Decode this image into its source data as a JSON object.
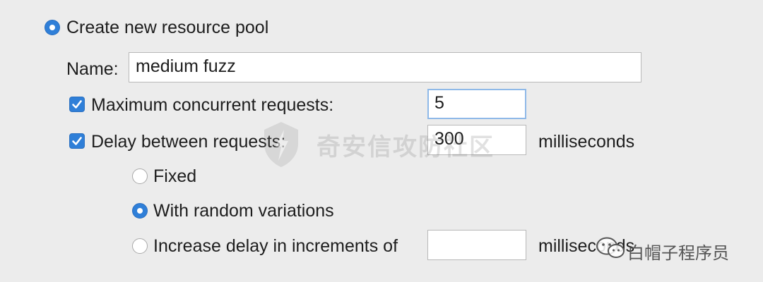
{
  "pool": {
    "create_label": "Create new resource pool",
    "name_label": "Name:",
    "name_value": "medium fuzz",
    "max_concurrent_label": "Maximum concurrent requests:",
    "max_concurrent_value": "5",
    "delay_label": "Delay between requests:",
    "delay_value": "300",
    "delay_unit": "milliseconds",
    "options": {
      "fixed": "Fixed",
      "random": "With random variations",
      "increase": "Increase delay in increments of"
    },
    "increase_value": "",
    "increase_unit": "milliseconds"
  },
  "watermark": {
    "text": "奇安信攻防社区",
    "footer": "白帽子程序员"
  }
}
